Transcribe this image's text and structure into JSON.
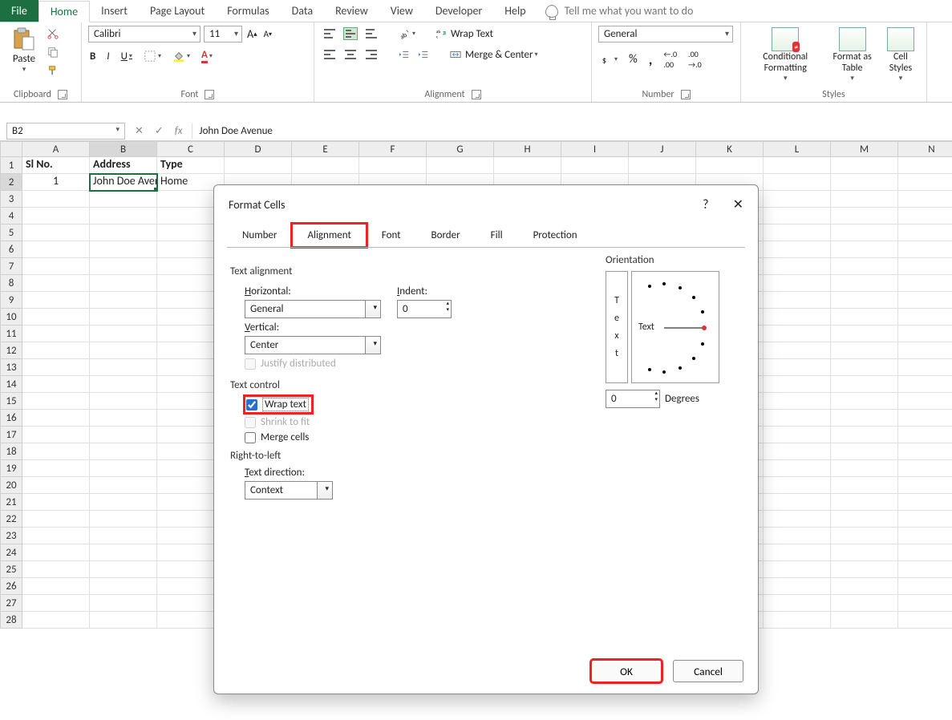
{
  "ribbon": {
    "tabs": {
      "file": "File",
      "home": "Home",
      "insert": "Insert",
      "pageLayout": "Page Layout",
      "formulas": "Formulas",
      "data": "Data",
      "review": "Review",
      "view": "View",
      "developer": "Developer",
      "help": "Help"
    },
    "tellme": "Tell me what you want to do",
    "groups": {
      "clipboard": "Clipboard",
      "font": "Font",
      "alignment": "Alignment",
      "number": "Number",
      "styles": "Styles"
    },
    "clipboard": {
      "paste": "Paste"
    },
    "font": {
      "name": "Calibri",
      "size": "11",
      "bold": "B",
      "italic": "I",
      "underline": "U"
    },
    "alignment": {
      "wrap": "Wrap Text",
      "merge": "Merge & Center"
    },
    "number": {
      "format": "General",
      "pct": "%",
      "comma": ",",
      "inc": ".00",
      "dec": ".0"
    },
    "styles": {
      "cf": "Conditional Formatting",
      "fat": "Format as Table",
      "cs": "Cell Styles"
    }
  },
  "namebox": "B2",
  "formula": "John Doe Avenue",
  "cols": [
    "A",
    "B",
    "C",
    "D",
    "E",
    "F",
    "G",
    "H",
    "I",
    "J",
    "K",
    "L",
    "M",
    "N"
  ],
  "rows": [
    "1",
    "2",
    "3",
    "4",
    "5",
    "6",
    "7",
    "8",
    "9",
    "10",
    "11",
    "12",
    "13",
    "14",
    "15",
    "16",
    "17",
    "18",
    "19",
    "20",
    "21",
    "22",
    "23",
    "24",
    "25",
    "26",
    "27",
    "28"
  ],
  "sheet": {
    "A1": "Sl No.",
    "B1": "Address",
    "C1": "Type",
    "A2": "1",
    "B2": "John Doe Avenue",
    "C2": "Home"
  },
  "dialog": {
    "title": "Format Cells",
    "tabs": {
      "number": "Number",
      "alignment": "Alignment",
      "font": "Font",
      "border": "Border",
      "fill": "Fill",
      "protection": "Protection"
    },
    "sections": {
      "textAlignment": "Text alignment",
      "horizontal": "Horizontal:",
      "vertical": "Vertical:",
      "indent": "Indent:",
      "justify": "Justify distributed",
      "textControl": "Text control",
      "wrap": "Wrap text",
      "shrink": "Shrink to fit",
      "merge": "Merge cells",
      "rtl": "Right-to-left",
      "textDir": "Text direction:",
      "orientation": "Orientation",
      "degrees": "Degrees"
    },
    "values": {
      "horizontal": "General",
      "vertical": "Center",
      "indent": "0",
      "textDir": "Context",
      "degrees": "0",
      "orientText": "Text"
    },
    "buttons": {
      "ok": "OK",
      "cancel": "Cancel"
    }
  }
}
